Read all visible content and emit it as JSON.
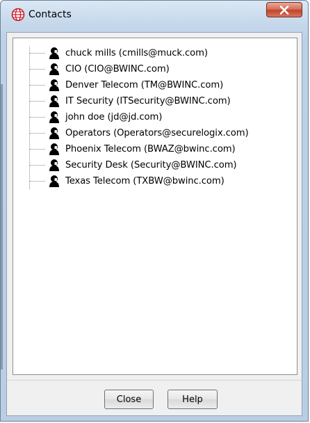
{
  "window": {
    "title": "Contacts"
  },
  "contacts": [
    {
      "label": "chuck mills (cmills@muck.com)"
    },
    {
      "label": "CIO (CIO@BWINC.com)"
    },
    {
      "label": "Denver Telecom  (TM@BWINC.com)"
    },
    {
      "label": "IT Security (ITSecurity@BWINC.com)"
    },
    {
      "label": "john doe (jd@jd.com)"
    },
    {
      "label": "Operators (Operators@securelogix.com)"
    },
    {
      "label": "Phoenix Telecom (BWAZ@bwinc.com)"
    },
    {
      "label": "Security Desk (Security@BWINC.com)"
    },
    {
      "label": "Texas Telecom (TXBW@bwinc.com)"
    }
  ],
  "buttons": {
    "close_label": "Close",
    "help_label": "Help"
  },
  "icons": {
    "app": "globe-icon",
    "contact": "person-icon",
    "window_close": "close-icon"
  },
  "colors": {
    "titlebar": "#c7d9ec",
    "close_button": "#c2432b",
    "panel_background": "#f0f0f0"
  }
}
